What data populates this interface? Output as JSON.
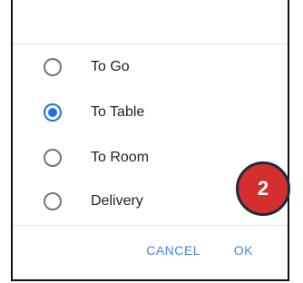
{
  "options": [
    {
      "label": "To Go",
      "selected": false
    },
    {
      "label": "To Table",
      "selected": true
    },
    {
      "label": "To Room",
      "selected": false
    },
    {
      "label": "Delivery",
      "selected": false
    }
  ],
  "actions": {
    "cancel_label": "CANCEL",
    "ok_label": "OK"
  },
  "step_badge": {
    "number": "2"
  },
  "colors": {
    "accent": "#1a73e8",
    "badge": "#d32f2f"
  }
}
